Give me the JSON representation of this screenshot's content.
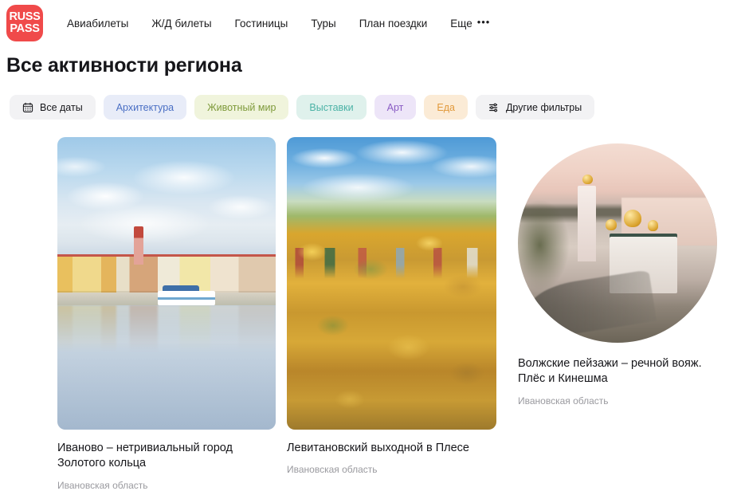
{
  "header": {
    "logo": {
      "line1": "RUSS",
      "line2": "PASS",
      "color": "#F04A4A"
    },
    "nav": [
      {
        "label": "Авиабилеты"
      },
      {
        "label": "Ж/Д билеты"
      },
      {
        "label": "Гостиницы"
      },
      {
        "label": "Туры"
      },
      {
        "label": "План поездки"
      },
      {
        "label": "Еще",
        "dots": "•••"
      }
    ]
  },
  "page": {
    "title": "Все активности региона"
  },
  "filters": [
    {
      "label": "Все даты",
      "icon": "calendar-icon",
      "bg": "#F2F2F4",
      "fg": "#16161A"
    },
    {
      "label": "Архитектура",
      "icon": null,
      "bg": "#E8ECF8",
      "fg": "#4A6FC4"
    },
    {
      "label": "Животный мир",
      "icon": null,
      "bg": "#F0F4DC",
      "fg": "#7E9A3A"
    },
    {
      "label": "Выставки",
      "icon": null,
      "bg": "#DFF1EC",
      "fg": "#4BB2A6"
    },
    {
      "label": "Арт",
      "icon": null,
      "bg": "#EDE5F8",
      "fg": "#8A5CC4"
    },
    {
      "label": "Еда",
      "icon": null,
      "bg": "#FBEBD6",
      "fg": "#E29A3C"
    },
    {
      "label": "Другие фильтры",
      "icon": "sliders-icon",
      "bg": "#F2F2F4",
      "fg": "#16161A"
    }
  ],
  "cards": [
    {
      "title": "Иваново – нетривиальный город Золотого кольца",
      "subtitle": "Ивановская область",
      "image_alt": "riverside-town-panorama"
    },
    {
      "title": "Левитановский выходной в Плесе",
      "subtitle": "Ивановская область",
      "image_alt": "autumn-hillside-town"
    },
    {
      "title": "Волжские пейзажи – речной вояж. Плёс и Кинешма",
      "subtitle": "Ивановская область",
      "image_alt": "orthodox-church-sunset-circle"
    }
  ]
}
